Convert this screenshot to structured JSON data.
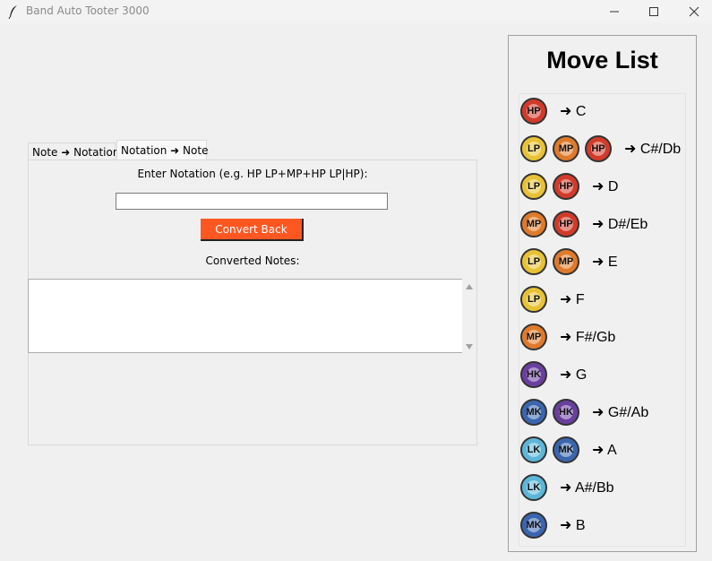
{
  "window": {
    "title": "Band Auto Tooter 3000"
  },
  "notebook": {
    "tabs": [
      {
        "label": "Note ➜ Notation"
      },
      {
        "label": "Notation ➜ Note"
      }
    ],
    "enter_label": "Enter Notation (e.g. HP LP+MP+HP LP|HP):",
    "input_value": "",
    "convert_button": "Convert Back",
    "converted_label": "Converted Notes:",
    "output_value": ""
  },
  "move_list": {
    "title": "Move List",
    "button_colors": {
      "LP": "#e8c234",
      "MP": "#e07a2a",
      "HP": "#d23a2a",
      "LK": "#5cb6d8",
      "MK": "#3a66b0",
      "HK": "#6a3fa0"
    },
    "rows": [
      {
        "buttons": [
          "HP"
        ],
        "note": "➜ C"
      },
      {
        "buttons": [
          "LP",
          "MP",
          "HP"
        ],
        "note": "➜ C#/Db"
      },
      {
        "buttons": [
          "LP",
          "HP"
        ],
        "note": "➜ D"
      },
      {
        "buttons": [
          "MP",
          "HP"
        ],
        "note": "➜ D#/Eb"
      },
      {
        "buttons": [
          "LP",
          "MP"
        ],
        "note": "➜ E"
      },
      {
        "buttons": [
          "LP"
        ],
        "note": "➜ F"
      },
      {
        "buttons": [
          "MP"
        ],
        "note": "➜ F#/Gb"
      },
      {
        "buttons": [
          "HK"
        ],
        "note": "➜ G"
      },
      {
        "buttons": [
          "MK",
          "HK"
        ],
        "note": "➜ G#/Ab"
      },
      {
        "buttons": [
          "LK",
          "MK"
        ],
        "note": "➜ A"
      },
      {
        "buttons": [
          "LK"
        ],
        "note": "➜ A#/Bb"
      },
      {
        "buttons": [
          "MK"
        ],
        "note": "➜ B"
      }
    ]
  }
}
